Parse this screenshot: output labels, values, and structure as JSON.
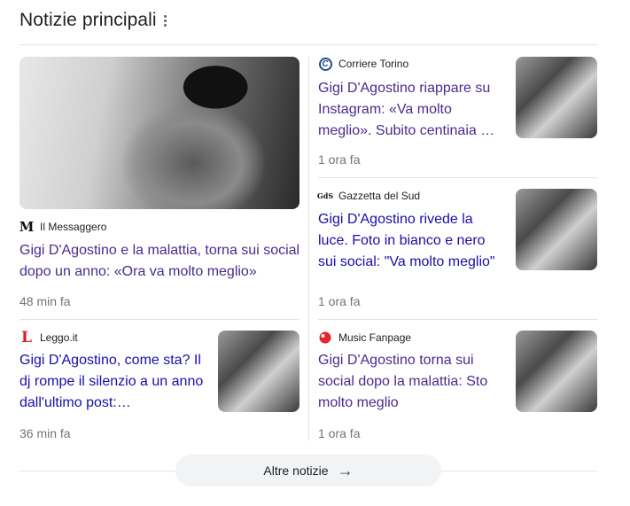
{
  "header": {
    "title": "Notizie principali"
  },
  "articles": [
    {
      "source": "Il Messaggero",
      "headline": "Gigi D'Agostino e la malattia, torna sui social dopo un anno: «Ora va molto meglio»",
      "time": "48 min fa"
    },
    {
      "source": "Corriere Torino",
      "headline": "Gigi D'Agostino riappare su Instagram: «Va molto meglio». Subito centinaia …",
      "time": "1 ora fa"
    },
    {
      "source": "Gazzetta del Sud",
      "headline": "Gigi D'Agostino rivede la luce. Foto in bianco e nero sui social: \"Va molto meglio\"",
      "time": "1 ora fa"
    },
    {
      "source": "Leggo.it",
      "headline": "Gigi D'Agostino, come sta? Il dj rompe il silenzio a un anno dall'ultimo post:…",
      "time": "36 min fa"
    },
    {
      "source": "Music Fanpage",
      "headline": "Gigi D'Agostino torna sui social dopo la malattia: Sto molto meglio",
      "time": "1 ora fa"
    }
  ],
  "logos": {
    "messaggero": "M",
    "corriere": "C",
    "gazzetta": "GdS",
    "leggo": "L"
  },
  "footer": {
    "more_label": "Altre notizie"
  }
}
